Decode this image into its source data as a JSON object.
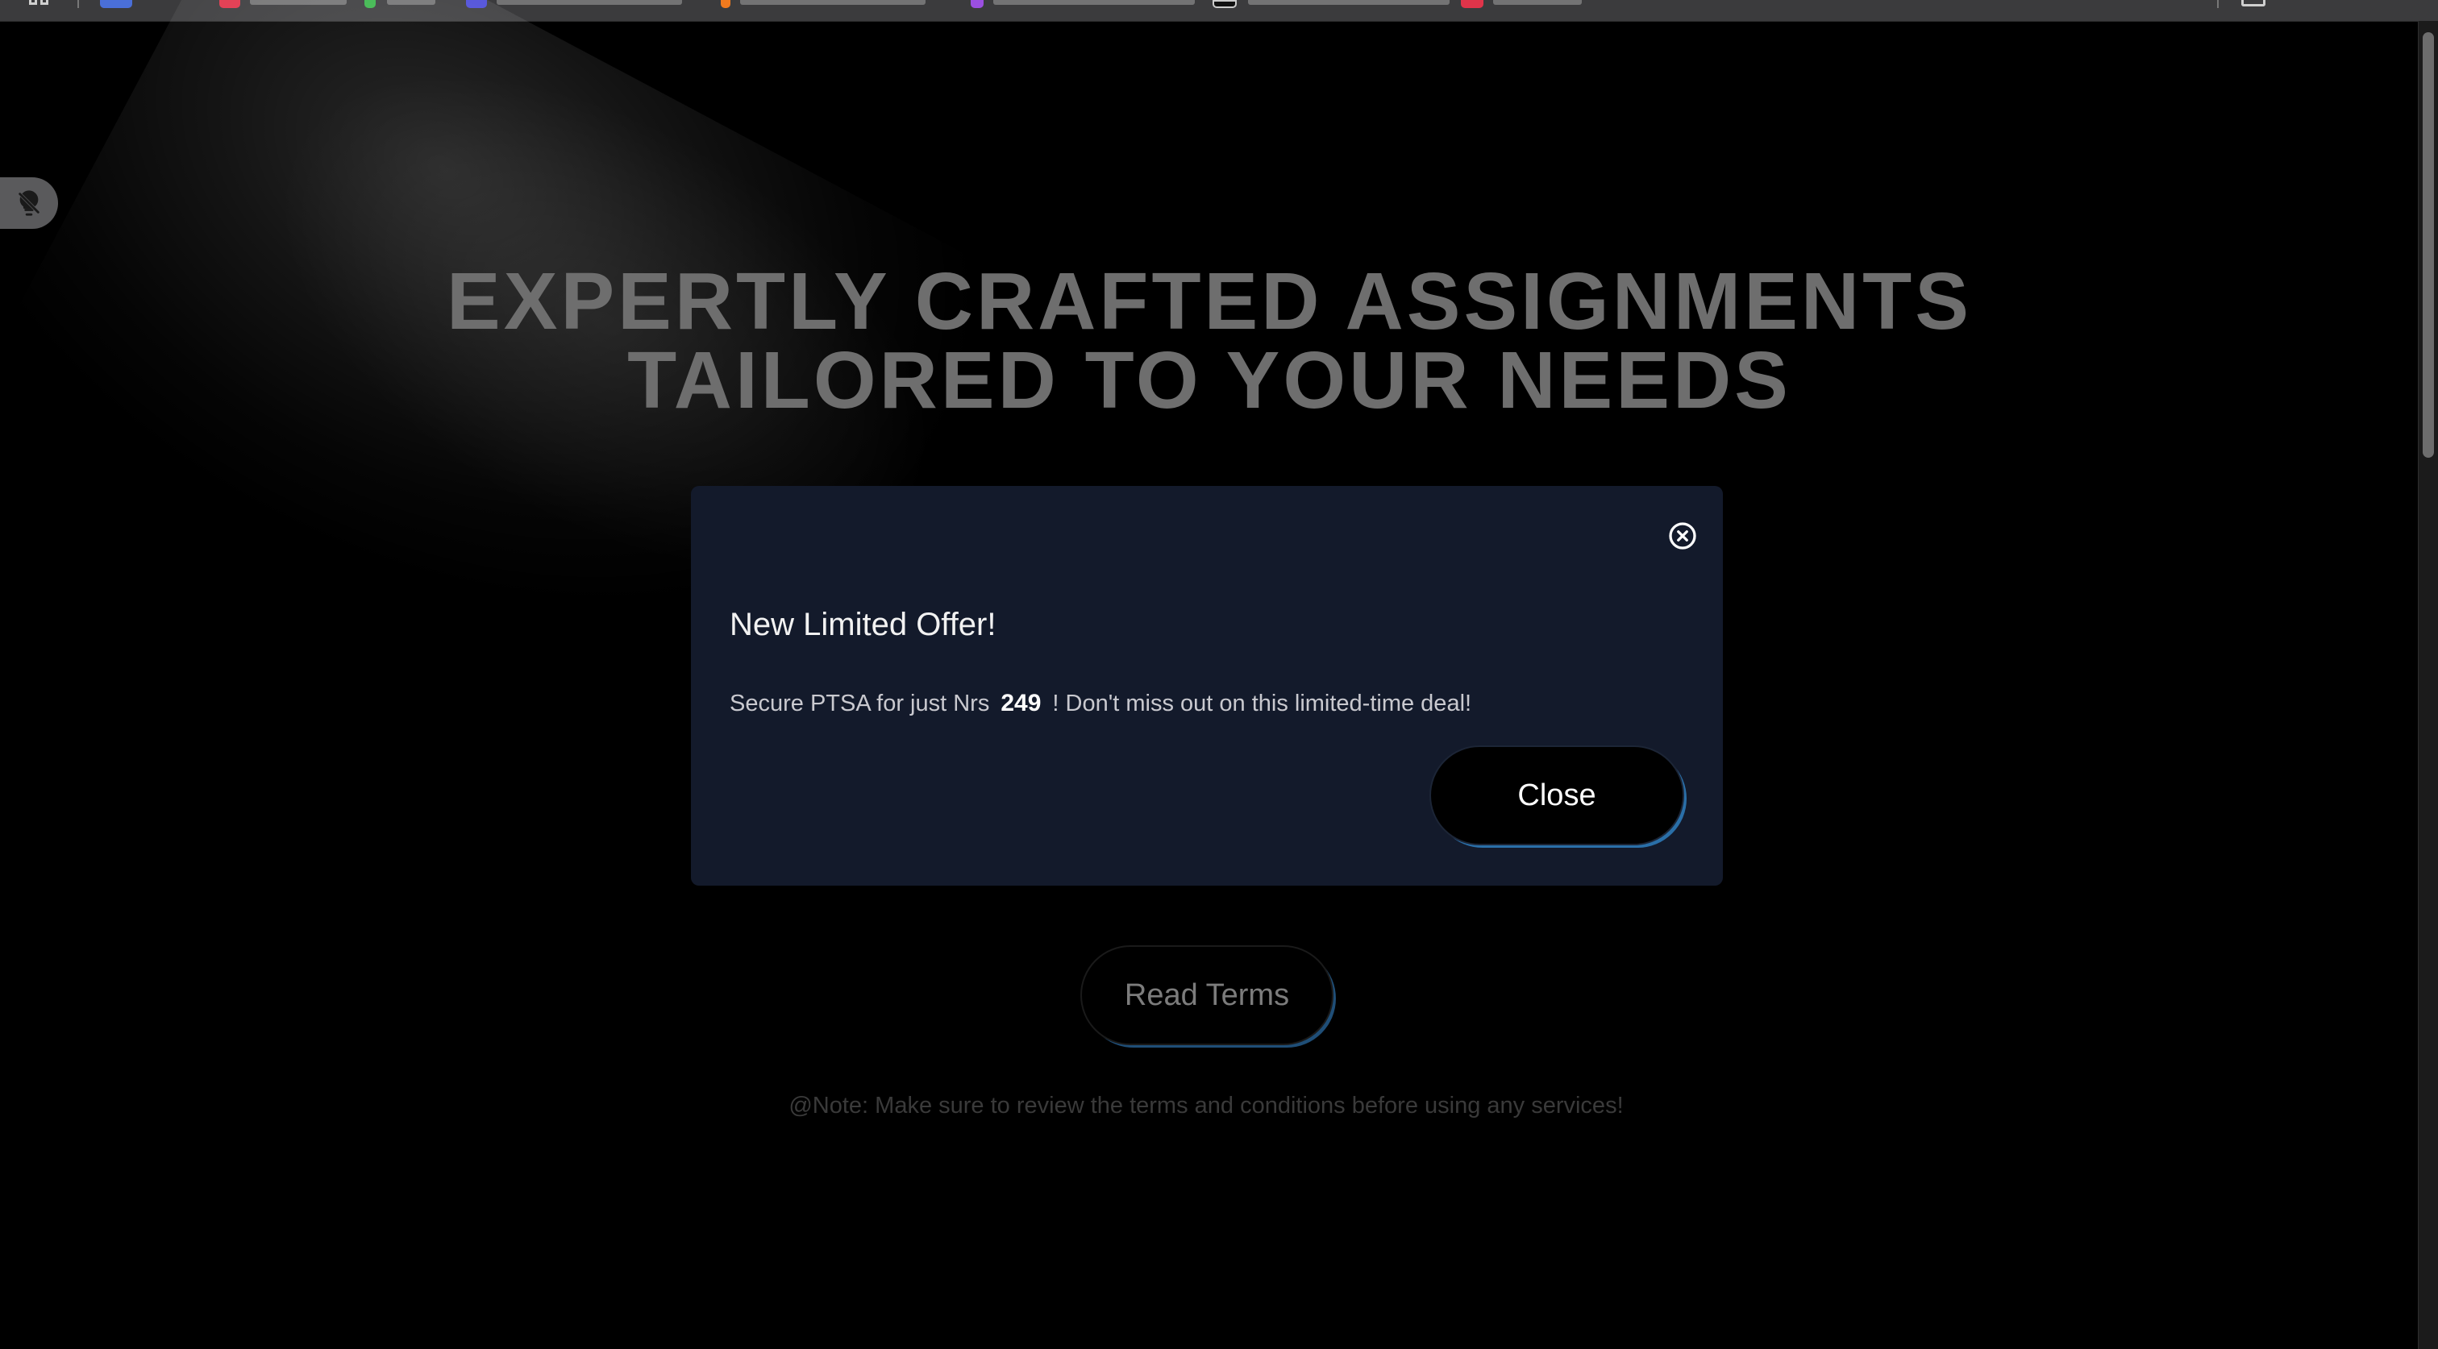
{
  "hero": {
    "line1": "EXPERTLY CRAFTED ASSIGNMENTS",
    "line2": "TAILORED TO YOUR NEEDS"
  },
  "modal": {
    "title": "New Limited Offer!",
    "text_before": "Secure PTSA for just Nrs",
    "price": "249",
    "text_after": "! Don't miss out on this limited-time deal!",
    "close_label": "Close",
    "close_icon": "close-circle-icon"
  },
  "actions": {
    "read_terms_label": "Read Terms"
  },
  "footer": {
    "note": "@Note: Make sure to review the terms and conditions before using any services!"
  },
  "side_toggle": {
    "icon": "lightbulb-off-icon"
  },
  "colors": {
    "background": "#000000",
    "modal_background": "#131a2b",
    "accent": "#2a6fa8"
  }
}
